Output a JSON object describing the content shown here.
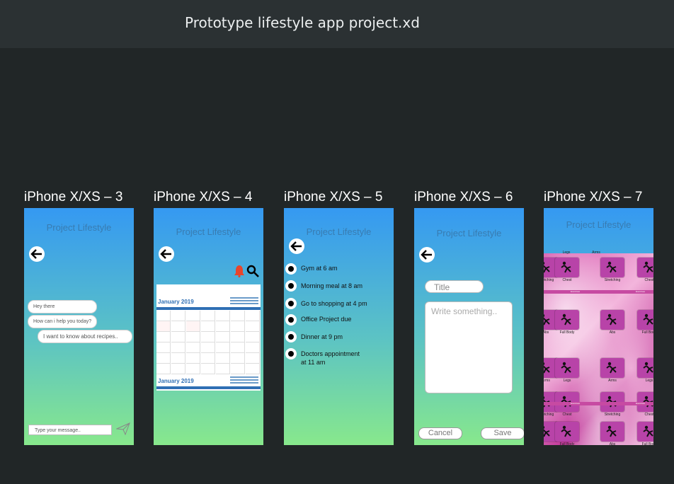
{
  "document": {
    "title": "Prototype lifestyle app project.xd"
  },
  "app_name": "Project Lifestyle",
  "artboards": [
    {
      "label": "iPhone X/XS – 3"
    },
    {
      "label": "iPhone X/XS – 4"
    },
    {
      "label": "iPhone X/XS – 5"
    },
    {
      "label": "iPhone X/XS – 6"
    },
    {
      "label": "iPhone X/XS – 7"
    }
  ],
  "chat": {
    "messages": [
      "Hey there",
      "How can i help you today?",
      "I want to know about recipes.."
    ],
    "input_placeholder": "Type your message.."
  },
  "calendar": {
    "month_label": "January 2019",
    "icons": [
      "bell-icon",
      "search-icon"
    ]
  },
  "todos": {
    "items": [
      "Gym at 6 am",
      "Morning meal at 8 am",
      "Go to shopping at 4 pm",
      "Office Project due",
      "Dinner at 9 pm",
      "Doctors appointment\nat 11 am"
    ]
  },
  "note": {
    "title_placeholder": "Title",
    "body_placeholder": "Write something..",
    "cancel_label": "Cancel",
    "save_label": "Save"
  },
  "exercises": {
    "rows": [
      [
        "Stretching",
        "Chest",
        "Stretching",
        "Chest"
      ],
      [
        "Abs",
        "Full Body",
        "Abs",
        "Full Body"
      ],
      [
        "Arms",
        "Legs",
        "Arms",
        "Legs"
      ],
      [
        "Stretching",
        "Chest",
        "Stretching",
        "Chest"
      ],
      [
        "",
        "Full Body",
        "Abs",
        "Full Body"
      ]
    ],
    "top_labels": [
      "Legs",
      "Arms"
    ],
    "divider_label": "Exercises"
  },
  "colors": {
    "gradient_top": "#3599f2",
    "gradient_bottom": "#88e88c",
    "exercise_tile": "#b843a8",
    "background": "#212627"
  }
}
